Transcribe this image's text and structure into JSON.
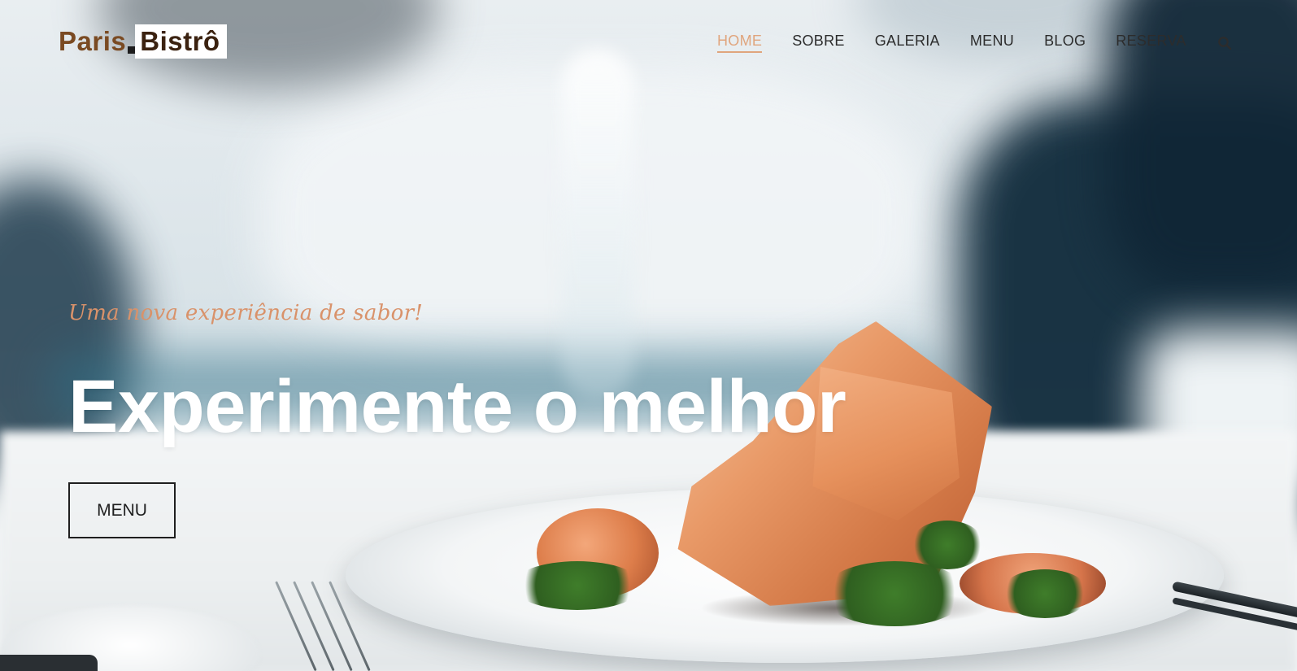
{
  "brand": {
    "logo_part1": "Paris",
    "logo_part2": "Bistrô",
    "text_color": "#7a4a22",
    "accent_color": "#e0a57d"
  },
  "nav": {
    "items": [
      {
        "label": "HOME",
        "active": true
      },
      {
        "label": "SOBRE",
        "active": false
      },
      {
        "label": "GALERIA",
        "active": false
      },
      {
        "label": "MENU",
        "active": false
      },
      {
        "label": "BLOG",
        "active": false
      },
      {
        "label": "RESERVA",
        "active": false
      }
    ],
    "search_icon": "search-icon"
  },
  "hero": {
    "tagline": "Uma nova experiência de sabor!",
    "headline": "Experimente o melhor",
    "button_label": "MENU",
    "tagline_color": "#d9926a",
    "headline_color": "#ffffff"
  }
}
